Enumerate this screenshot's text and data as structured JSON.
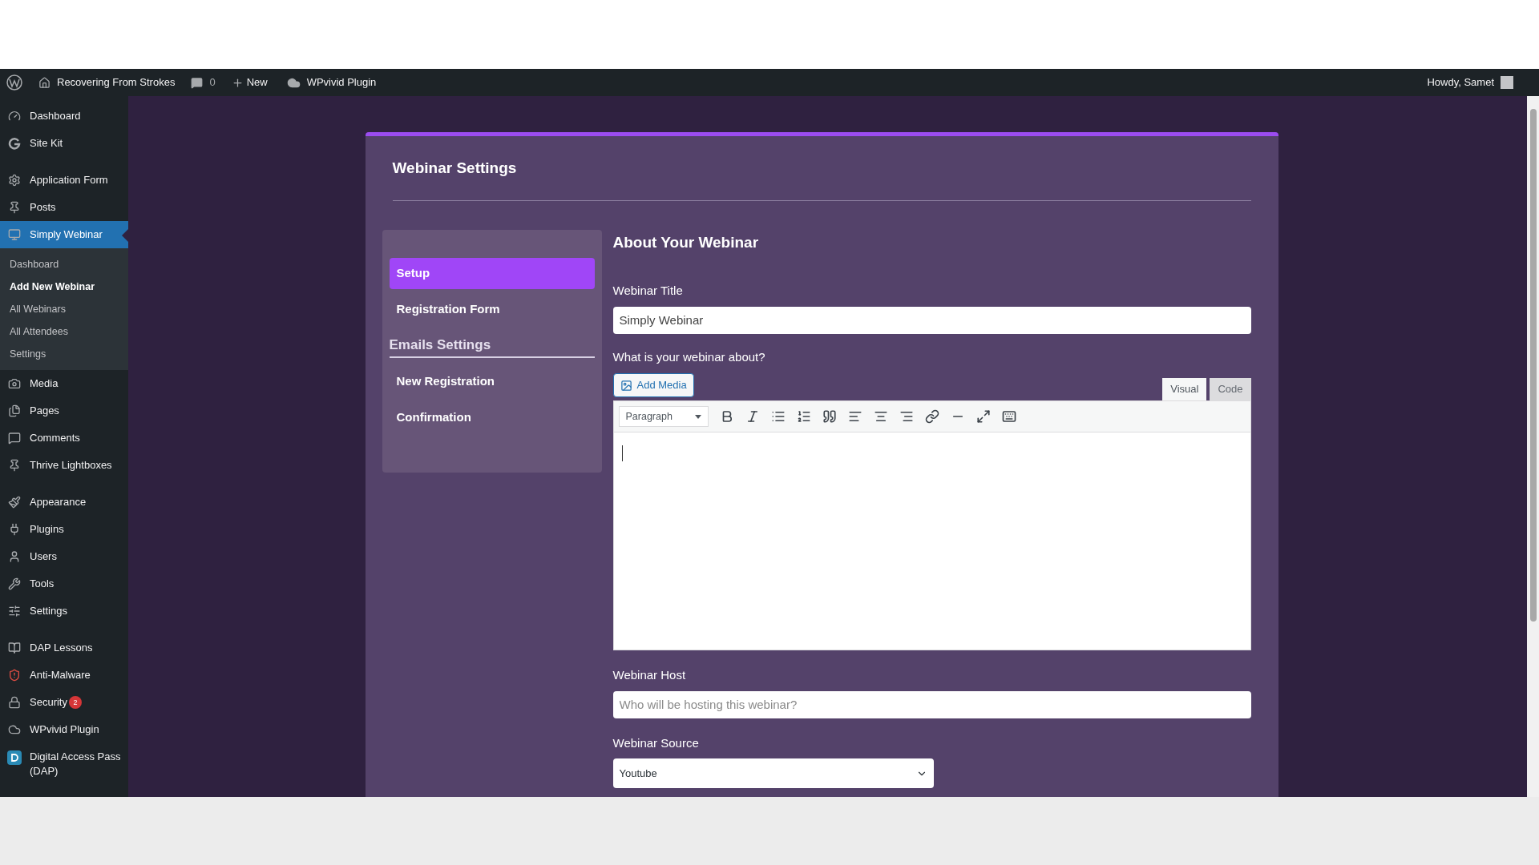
{
  "admin_bar": {
    "site": "Recovering From Strokes",
    "comments": "0",
    "new": "New",
    "plugin": "WPvivid Plugin",
    "greeting": "Howdy, Samet"
  },
  "sidebar": {
    "groups": [
      [
        {
          "label": "Dashboard",
          "selected": false
        },
        {
          "label": "Site Kit",
          "selected": false
        }
      ],
      [
        {
          "label": "Application Form",
          "selected": false
        },
        {
          "label": "Posts",
          "selected": false
        },
        {
          "label": "Simply Webinar",
          "selected": true,
          "children": [
            {
              "label": "Dashboard",
              "selected": false
            },
            {
              "label": "Add New Webinar",
              "selected": true
            },
            {
              "label": "All Webinars",
              "selected": false
            },
            {
              "label": "All Attendees",
              "selected": false
            },
            {
              "label": "Settings",
              "selected": false
            }
          ]
        },
        {
          "label": "Media",
          "selected": false
        },
        {
          "label": "Pages",
          "selected": false
        },
        {
          "label": "Comments",
          "selected": false
        },
        {
          "label": "Thrive Lightboxes",
          "selected": false
        }
      ],
      [
        {
          "label": "Appearance",
          "selected": false
        },
        {
          "label": "Plugins",
          "selected": false
        },
        {
          "label": "Users",
          "selected": false
        },
        {
          "label": "Tools",
          "selected": false
        },
        {
          "label": "Settings",
          "selected": false
        }
      ],
      [
        {
          "label": "DAP Lessons",
          "selected": false
        },
        {
          "label": "Anti-Malware",
          "selected": false
        },
        {
          "label": "Security",
          "selected": false,
          "badge": "2"
        },
        {
          "label": "WPvivid Plugin",
          "selected": false
        },
        {
          "label": "Digital Access Pass (DAP)",
          "selected": false
        }
      ]
    ]
  },
  "card": {
    "title": "Webinar Settings",
    "nav": [
      {
        "kind": "item",
        "label": "Setup",
        "selected": true
      },
      {
        "kind": "item",
        "label": "Registration Form",
        "selected": false
      },
      {
        "kind": "heading",
        "label": "Emails Settings"
      },
      {
        "kind": "item",
        "label": "New Registration",
        "selected": false
      },
      {
        "kind": "item",
        "label": "Confirmation",
        "selected": false
      }
    ],
    "heading": "About Your Webinar",
    "title_label": "Webinar Title",
    "title_value": "Simply Webinar",
    "about_label": "What is your webinar about?",
    "add_media": "Add Media",
    "editor_tabs": [
      {
        "label": "Visual",
        "selected": true
      },
      {
        "label": "Code",
        "selected": false
      }
    ],
    "format": "Paragraph",
    "host_label": "Webinar Host",
    "host_placeholder": "Who will be hosting this webinar?",
    "source_label": "Webinar Source",
    "source_value": "Youtube"
  }
}
